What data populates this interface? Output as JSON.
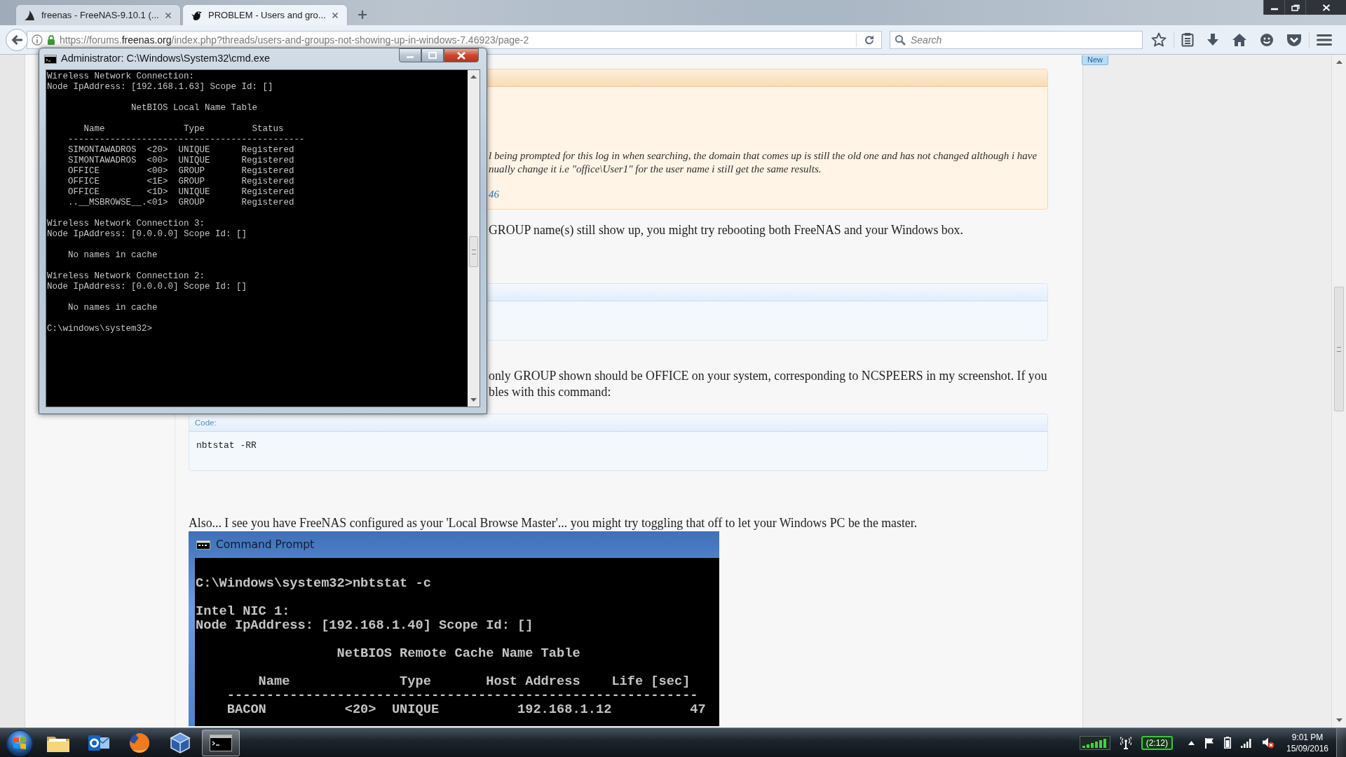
{
  "browser": {
    "tabs": [
      {
        "title": "freenas - FreeNAS-9.10.1 (...",
        "selected": false
      },
      {
        "title": "PROBLEM - Users and gro...",
        "selected": true
      }
    ],
    "url": {
      "scheme": "https://forums.",
      "domain": "freenas.org",
      "path": "/index.php?threads/users-and-groups-not-showing-up-in-windows-7.46923/page-2"
    },
    "search": {
      "placeholder": "Search"
    }
  },
  "page": {
    "badge": "New",
    "blocks": [
      {
        "kind": "quote",
        "under_window": true,
        "lines": [
          "l being prompted for this log in when searching, the domain that comes up is still the old one and has not changed although i have",
          "nually change it i.e \"office\\User1\" for the user name i still get the same results."
        ],
        "link": "46"
      },
      {
        "kind": "text",
        "under_window": true,
        "lines": [
          "GROUP name(s) still show up, you might try rebooting both FreeNAS and your Windows box."
        ]
      },
      {
        "kind": "code"
      },
      {
        "kind": "text",
        "under_window": true,
        "lines": [
          "only GROUP shown should be OFFICE on your system, corresponding to NCSPEERS in my screenshot. If you",
          "bles with this command:"
        ]
      },
      {
        "kind": "code",
        "label": "Code:",
        "code": "nbtstat -RR"
      },
      {
        "kind": "text",
        "under_window": false,
        "lines": [
          "Also... I see you have FreeNAS configured as your 'Local Browse Master'... you might try toggling that off to let your Windows PC be the master."
        ]
      },
      {
        "kind": "screenshot",
        "title": "Command Prompt",
        "blocks": [
          [
            "C:\\Windows\\system32>nbtstat -c"
          ],
          [
            "Intel NIC 1:",
            "Node IpAddress: [192.168.1.40] Scope Id: []"
          ],
          [
            "                  NetBIOS Remote Cache Name Table"
          ],
          [
            "        Name              Type       Host Address    Life [sec]",
            "    ------------------------------------------------------------",
            "    BACON          <20>  UNIQUE          192.168.1.12          47"
          ]
        ]
      }
    ]
  },
  "console_window": {
    "title": "Administrator: C:\\Windows\\System32\\cmd.exe",
    "blocks": [
      [
        "Wireless Network Connection:",
        "Node IpAddress: [192.168.1.63] Scope Id: []"
      ],
      [
        "                NetBIOS Local Name Table"
      ],
      [
        "       Name               Type         Status",
        "    ---------------------------------------------",
        "    SIMONTAWADROS  <20>  UNIQUE      Registered",
        "    SIMONTAWADROS  <00>  UNIQUE      Registered",
        "    OFFICE         <00>  GROUP       Registered",
        "    OFFICE         <1E>  GROUP       Registered",
        "    OFFICE         <1D>  UNIQUE      Registered",
        "    ..__MSBROWSE__.<01>  GROUP       Registered"
      ],
      [
        "Wireless Network Connection 3:",
        "Node IpAddress: [0.0.0.0] Scope Id: []"
      ],
      [
        "    No names in cache"
      ],
      [
        "Wireless Network Connection 2:",
        "Node IpAddress: [0.0.0.0] Scope Id: []"
      ],
      [
        "    No names in cache"
      ],
      [
        "C:\\windows\\system32>"
      ]
    ]
  },
  "taskbar": {
    "apps": [
      {
        "kind": "folder",
        "selected": false
      },
      {
        "kind": "mail",
        "selected": false
      },
      {
        "kind": "globe",
        "selected": false
      },
      {
        "kind": "cube",
        "selected": false
      },
      {
        "kind": "terminal",
        "selected": true
      }
    ],
    "battery_time": "(2:12)",
    "time": "9:01 PM",
    "date": "15/09/2016"
  }
}
